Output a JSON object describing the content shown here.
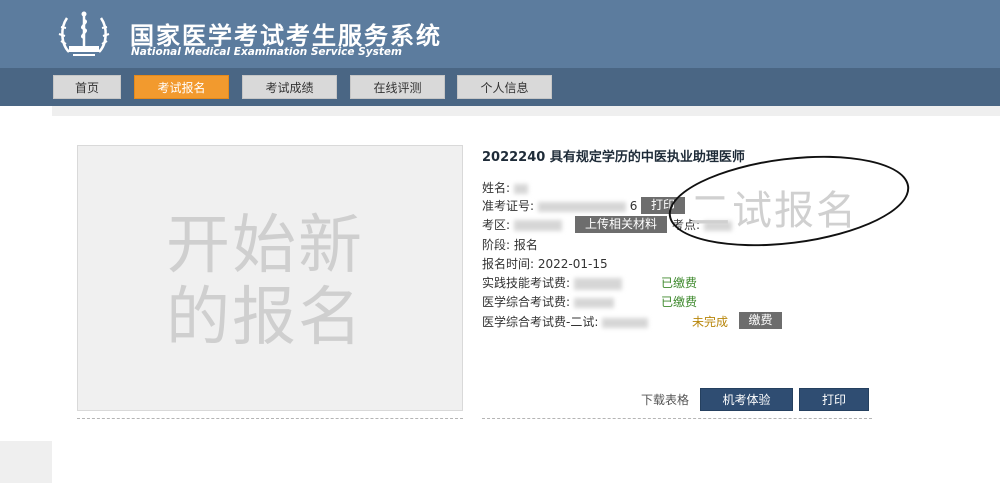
{
  "header": {
    "title": "国家医学考试考生服务系统",
    "subtitle": "National Medical Examination Service System",
    "logo_icon": "medical-emblem-logo"
  },
  "nav": {
    "items": [
      {
        "label": "首页",
        "active": false
      },
      {
        "label": "考试报名",
        "active": true
      },
      {
        "label": "考试成绩",
        "active": false
      },
      {
        "label": "在线评测",
        "active": false
      },
      {
        "label": "个人信息",
        "active": false
      }
    ],
    "active_color": "#f29a2e"
  },
  "new_registration": {
    "label": "开始新的报名"
  },
  "registration": {
    "title": "2022240 具有规定学历的中医执业助理医师",
    "name_label": "姓名:",
    "ticket_label": "准考证号:",
    "ticket_digit": "6",
    "print_small": "打印",
    "exam_area_label": "考区:",
    "upload_button": "上传相关材料",
    "exam_site_label": "考点:",
    "stage_label": "阶段:",
    "stage_value": "报名",
    "reg_time_label": "报名时间:",
    "reg_time_value": "2022-01-15",
    "fees": [
      {
        "label": "实践技能考试费:",
        "status": "已缴费",
        "paid": true
      },
      {
        "label": "医学综合考试费:",
        "status": "已缴费",
        "paid": true
      },
      {
        "label": "医学综合考试费-二试:",
        "status": "未完成",
        "paid": false,
        "action": "缴费"
      }
    ],
    "second_exam_text": "二试报名"
  },
  "actions": {
    "download": "下载表格",
    "mock_exam": "机考体验",
    "print": "打印"
  },
  "colors": {
    "header_bg": "#5c7c9e",
    "nav_bg": "#4a6684",
    "paid": "#3f8a2e",
    "unpaid": "#b8860b",
    "primary_button": "#2f4d72"
  }
}
